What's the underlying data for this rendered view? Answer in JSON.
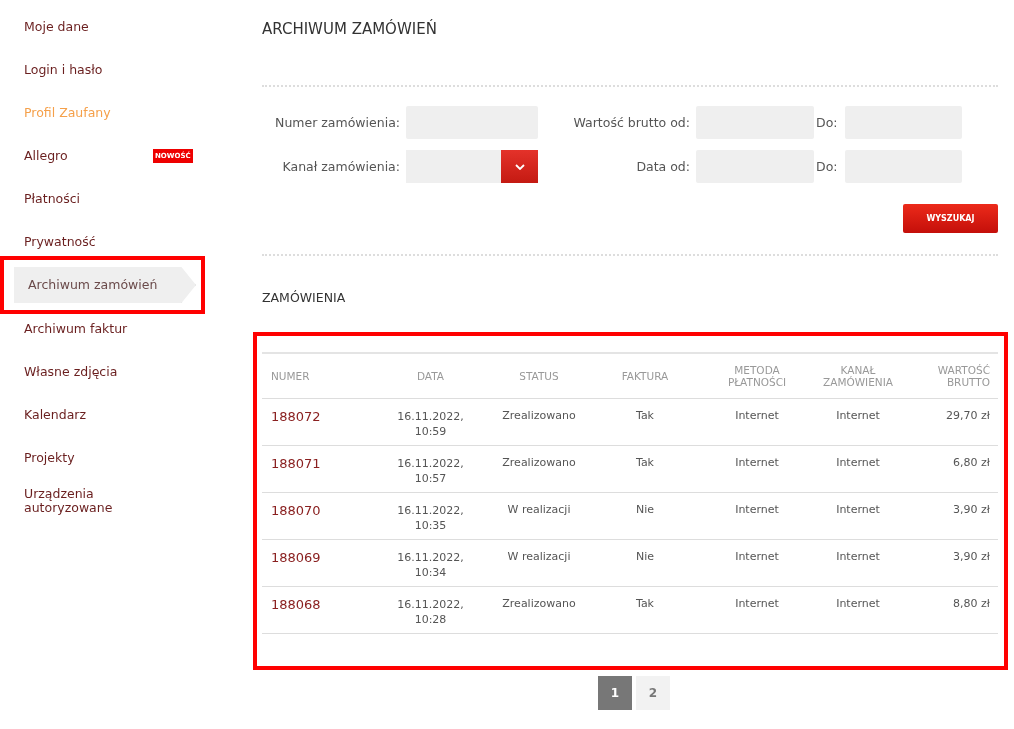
{
  "sidebar": {
    "items": [
      {
        "label": "Moje dane",
        "kind": "link",
        "selected": false,
        "highlighted": false
      },
      {
        "label": "Login i hasło",
        "kind": "link",
        "selected": false,
        "highlighted": false
      },
      {
        "label": "Profil Zaufany",
        "kind": "accent",
        "selected": false,
        "highlighted": false
      },
      {
        "label": "Allegro",
        "kind": "link",
        "selected": false,
        "highlighted": false,
        "badge": "NOWOŚĆ"
      },
      {
        "label": "Płatności",
        "kind": "link",
        "selected": false,
        "highlighted": false
      },
      {
        "label": "Prywatność",
        "kind": "link",
        "selected": false,
        "highlighted": false
      },
      {
        "label": "Archiwum zamówień",
        "kind": "link",
        "selected": true,
        "highlighted": true
      },
      {
        "label": "Archiwum faktur",
        "kind": "link",
        "selected": false,
        "highlighted": false
      },
      {
        "label": "Własne zdjęcia",
        "kind": "link",
        "selected": false,
        "highlighted": false
      },
      {
        "label": "Kalendarz",
        "kind": "link",
        "selected": false,
        "highlighted": false
      },
      {
        "label": "Projekty",
        "kind": "link",
        "selected": false,
        "highlighted": false
      },
      {
        "label": "Urządzenia autoryzowane",
        "kind": "link",
        "selected": false,
        "highlighted": false
      }
    ]
  },
  "page_title": "ARCHIWUM ZAMÓWIEŃ",
  "filters": {
    "rows": [
      [
        {
          "label": "Numer zamówienia:",
          "kind": "text"
        },
        {
          "label": "Wartość brutto od:",
          "kind": "text"
        },
        {
          "label": "Do:",
          "kind": "text"
        }
      ],
      [
        {
          "label": "Kanał zamówienia:",
          "kind": "select"
        },
        {
          "label": "Data od:",
          "kind": "text"
        },
        {
          "label": "Do:",
          "kind": "text"
        }
      ]
    ],
    "search_button": "WYSZUKAJ"
  },
  "orders": {
    "title": "ZAMÓWIENIA",
    "highlighted": true,
    "columns": [
      "NUMER",
      "DATA",
      "STATUS",
      "FAKTURA",
      "METODA PŁATNOŚCI",
      "KANAŁ ZAMÓWIENIA",
      "WARTOŚĆ BRUTTO"
    ],
    "rows": [
      {
        "number": "188072",
        "date": "16.11.2022,",
        "time": "10:59",
        "status": "Zrealizowano",
        "invoice": "Tak",
        "payment": "Internet",
        "channel": "Internet",
        "value": "29,70 zł"
      },
      {
        "number": "188071",
        "date": "16.11.2022,",
        "time": "10:57",
        "status": "Zrealizowano",
        "invoice": "Tak",
        "payment": "Internet",
        "channel": "Internet",
        "value": "6,80 zł"
      },
      {
        "number": "188070",
        "date": "16.11.2022,",
        "time": "10:35",
        "status": "W realizacji",
        "invoice": "Nie",
        "payment": "Internet",
        "channel": "Internet",
        "value": "3,90 zł"
      },
      {
        "number": "188069",
        "date": "16.11.2022,",
        "time": "10:34",
        "status": "W realizacji",
        "invoice": "Nie",
        "payment": "Internet",
        "channel": "Internet",
        "value": "3,90 zł"
      },
      {
        "number": "188068",
        "date": "16.11.2022,",
        "time": "10:28",
        "status": "Zrealizowano",
        "invoice": "Tak",
        "payment": "Internet",
        "channel": "Internet",
        "value": "8,80 zł"
      }
    ]
  },
  "pagination": [
    {
      "label": "1",
      "selected": true
    },
    {
      "label": "2",
      "selected": false
    }
  ]
}
